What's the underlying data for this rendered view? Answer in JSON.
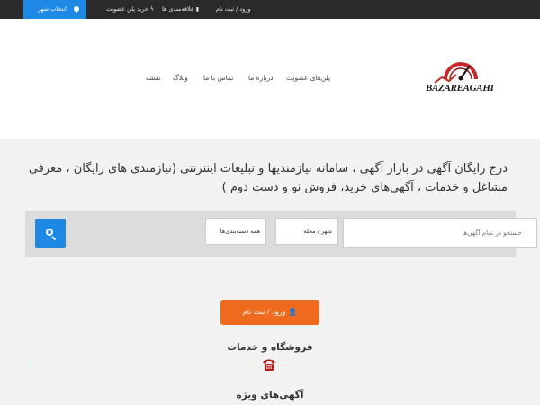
{
  "topbar": {
    "city_label": "انتخاب شهر",
    "buy_plan_label": "خرید پلن عضویت",
    "favorites_label": "علاقه‌مندی ها",
    "login_label": "ورود / ثبت نام"
  },
  "header": {
    "logo_text": "BAZAREAGAHI",
    "nav": {
      "plans": "پلن‌های عضویت",
      "about": "درباره ما",
      "contact": "تماس با ما",
      "blog": "وبلاگ",
      "map": "نقشه"
    }
  },
  "hero": {
    "text": "درج رایگان آگهی در بازار آگهی ، سامانه نیازمندیها و تبلیغات اینترنتی (نیازمندی های رایگان ، معرفی مشاغل و خدمات ، آگهی‌های خرید، فروش نو و دست دوم )"
  },
  "search": {
    "placeholder": "جستجو در تمام آگهی‌ها",
    "city_select": "شهر / محله",
    "category_select": "همه دسته‌بندی‌ها"
  },
  "login_button": "ورود / ثبت نام",
  "sections": {
    "shops_title": "فروشگاه و خدمات",
    "featured_title": "آگهی‌های ویژه"
  },
  "colors": {
    "topbar_bg": "#2a2a2a",
    "accent_blue": "#1e88e5",
    "accent_orange": "#f06a1d",
    "divider_red": "#b71c1c"
  }
}
